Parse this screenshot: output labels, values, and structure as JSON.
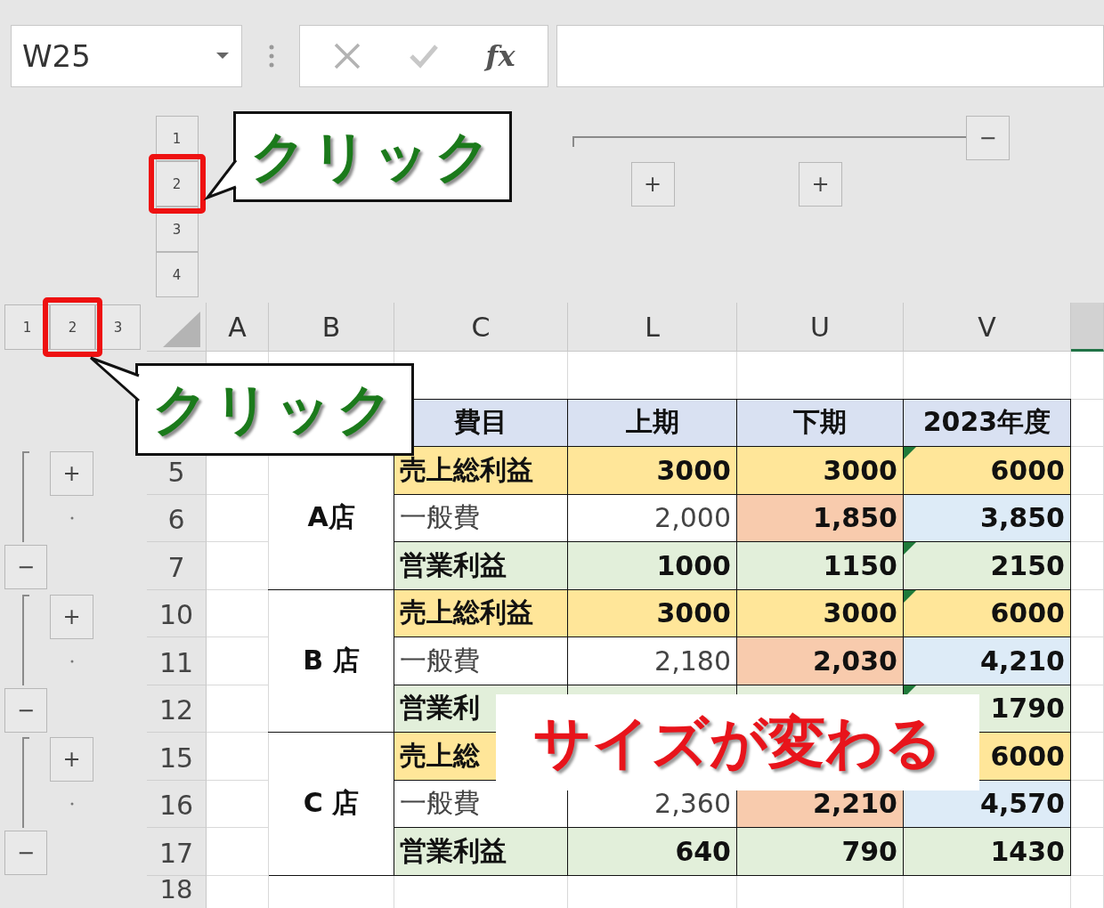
{
  "name_box": {
    "value": "W25"
  },
  "formula_bar": {
    "function_label": "fx"
  },
  "column_outline": {
    "levels": [
      {
        "label": "1",
        "highlighted": false
      },
      {
        "label": "2",
        "highlighted": true
      },
      {
        "label": "3",
        "highlighted": false
      },
      {
        "label": "4",
        "highlighted": false
      }
    ],
    "collapse": "−",
    "expand_buttons": [
      "+",
      "+"
    ]
  },
  "row_outline": {
    "levels": [
      {
        "label": "1",
        "highlighted": false
      },
      {
        "label": "2",
        "highlighted": true
      },
      {
        "label": "3",
        "highlighted": false
      }
    ],
    "groups": [
      {
        "expand": "+",
        "collapse": "−"
      },
      {
        "expand": "+",
        "collapse": "−"
      },
      {
        "expand": "+",
        "collapse": "−"
      }
    ]
  },
  "sheet": {
    "columns": [
      {
        "label": "A",
        "selected": false
      },
      {
        "label": "B",
        "selected": false
      },
      {
        "label": "C",
        "selected": false
      },
      {
        "label": "L",
        "selected": false
      },
      {
        "label": "U",
        "selected": false
      },
      {
        "label": "V",
        "selected": false
      },
      {
        "selected": true
      }
    ],
    "header_row": {
      "item": "費目",
      "h1": "上期",
      "h2": "下期",
      "year": "2023年度"
    },
    "stores": [
      {
        "name": "A店",
        "rows": [
          {
            "number": "5",
            "kind": "gross",
            "item": "売上総利益",
            "h1": "3000",
            "h2": "3000",
            "year": "6000",
            "marker": true
          },
          {
            "number": "6",
            "kind": "expense",
            "item": "一般費",
            "h1": "2,000",
            "h2": "1,850",
            "year": "3,850",
            "marker": false
          },
          {
            "number": "7",
            "kind": "operating",
            "item": "営業利益",
            "h1": "1000",
            "h2": "1150",
            "year": "2150",
            "marker": true
          }
        ]
      },
      {
        "name": "B 店",
        "rows": [
          {
            "number": "10",
            "kind": "gross",
            "item": "売上総利益",
            "h1": "3000",
            "h2": "3000",
            "year": "6000",
            "marker": true
          },
          {
            "number": "11",
            "kind": "expense",
            "item": "一般費",
            "h1": "2,180",
            "h2": "2,030",
            "year": "4,210",
            "marker": false
          },
          {
            "number": "12",
            "kind": "operating",
            "item": "営業利",
            "year": "1790",
            "marker": true
          }
        ]
      },
      {
        "name": "C 店",
        "rows": [
          {
            "number": "15",
            "kind": "gross",
            "item": "売上総",
            "year": "6000",
            "marker": false,
            "h1_covered": true
          },
          {
            "number": "16",
            "kind": "expense",
            "item": "一般費",
            "h1": "2,360",
            "h2": "2,210",
            "year": "4,570",
            "marker": false
          },
          {
            "number": "17",
            "kind": "operating",
            "item": "営業利益",
            "h1": "640",
            "h2": "790",
            "year": "1430",
            "marker": false
          }
        ]
      }
    ],
    "trailing_rows": [
      {
        "number": "18"
      }
    ]
  },
  "annotations": {
    "callouts": [
      {
        "text": "クリック"
      },
      {
        "text": "クリック"
      }
    ],
    "banner": {
      "text": "サイズが変わる"
    }
  }
}
